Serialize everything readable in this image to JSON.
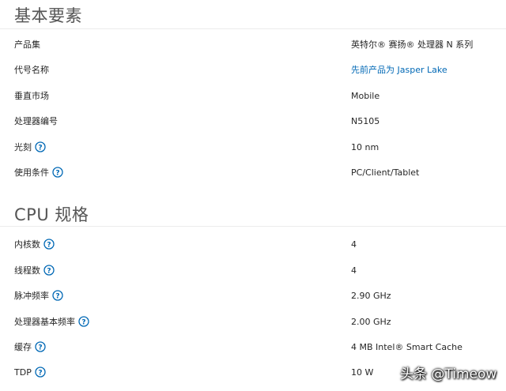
{
  "sections": [
    {
      "title": "基本要素",
      "rows": [
        {
          "label": "产品集",
          "value": "英特尔® 赛扬® 处理器 N 系列"
        },
        {
          "label": "代号名称",
          "value": "先前产品为 Jasper Lake",
          "link": true
        },
        {
          "label": "垂直市场",
          "value": "Mobile"
        },
        {
          "label": "处理器编号",
          "value": "N5105"
        },
        {
          "label": "光刻",
          "value": "10 nm",
          "help": true
        },
        {
          "label": "使用条件",
          "value": "PC/Client/Tablet",
          "help": true
        }
      ]
    },
    {
      "title": "CPU 规格",
      "rows": [
        {
          "label": "内核数",
          "value": "4",
          "help": true
        },
        {
          "label": "线程数",
          "value": "4",
          "help": true
        },
        {
          "label": "脉冲频率",
          "value": "2.90 GHz",
          "help": true
        },
        {
          "label": "处理器基本频率",
          "value": "2.00 GHz",
          "help": true
        },
        {
          "label": "缓存",
          "value": "4 MB Intel® Smart Cache",
          "help": true
        },
        {
          "label": "TDP",
          "value": "10 W",
          "help": true
        }
      ]
    }
  ],
  "help_icon": "question-circle-icon",
  "colors": {
    "link": "#0068b5",
    "help_icon": "#0068b5",
    "divider": "#ececec",
    "title": "#555555"
  },
  "watermark": "头条 @Timeow"
}
